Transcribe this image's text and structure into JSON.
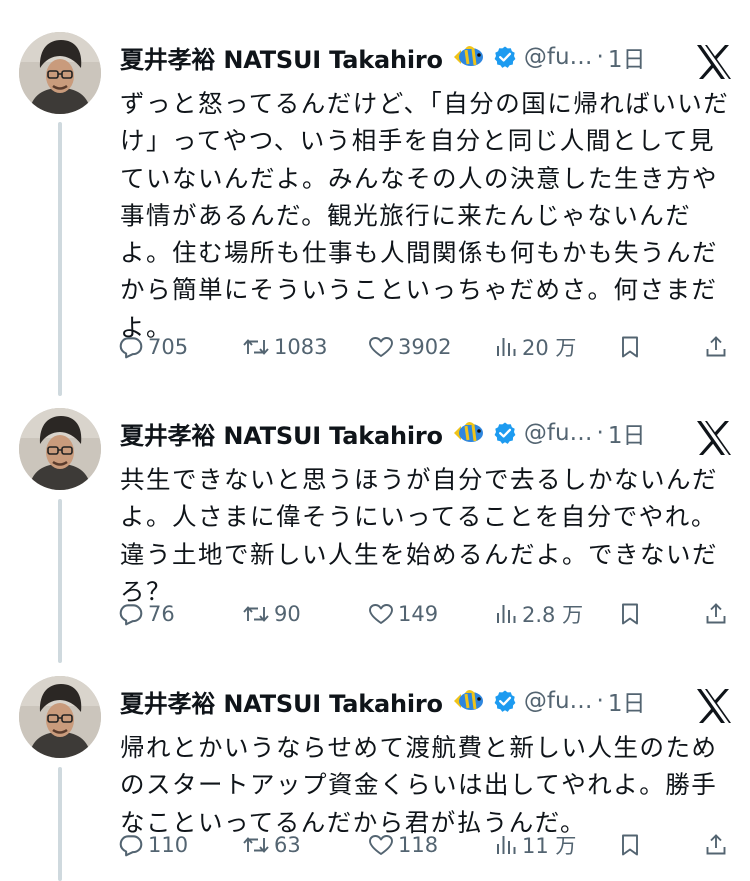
{
  "author": {
    "name": "夏井孝裕 NATSUI Takahiro",
    "emoji": "🐠",
    "handle": "@fu…",
    "separator": "·"
  },
  "tweets": [
    {
      "time": "1日",
      "text": "ずっと怒ってるんだけど、「自分の国に帰ればいいだけ」ってやつ、いう相手を自分と同じ人間として見ていないんだよ。みんなその人の決意した生き方や事情があるんだ。観光旅行に来たんじゃないんだよ。住む場所も仕事も人間関係も何もかも失うんだから簡単にそういうこといっちゃだめさ。何さまだよ。",
      "replies": "705",
      "retweets": "1083",
      "likes": "3902",
      "views": "20 万"
    },
    {
      "time": "1日",
      "text": "共生できないと思うほうが自分で去るしかないんだよ。人さまに偉そうにいってることを自分でやれ。違う土地で新しい人生を始めるんだよ。できないだろ？",
      "replies": "76",
      "retweets": "90",
      "likes": "149",
      "views": "2.8 万"
    },
    {
      "time": "1日",
      "text": "帰れとかいうならせめて渡航費と新しい人生のためのスタートアップ資金くらいは出してやれよ。勝手なこといってるんだから君が払うんだ。",
      "replies": "110",
      "retweets": "63",
      "likes": "118",
      "views": "11 万"
    }
  ],
  "icons": {
    "reply": "reply-bubble-icon",
    "retweet": "retweet-icon",
    "like": "heart-icon",
    "views": "views-bar-chart-icon",
    "bookmark": "bookmark-icon",
    "share": "share-icon",
    "verified": "verified-badge-icon",
    "platform": "x-logo-icon"
  },
  "colors": {
    "text": "#0f1419",
    "secondary": "#536471",
    "verified": "#1d9bf0",
    "thread_line": "#cfd9de"
  }
}
